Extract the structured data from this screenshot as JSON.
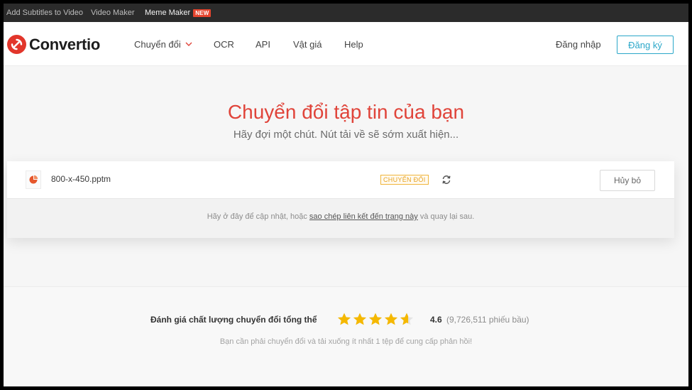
{
  "top_strip": {
    "links": [
      "Add Subtitles to Video",
      "Video Maker",
      "Meme Maker"
    ],
    "new_badge": "NEW"
  },
  "header": {
    "brand": "Convertio",
    "nav": {
      "convert": "Chuyển đổi",
      "ocr": "OCR",
      "api": "API",
      "price": "Vật giá",
      "help": "Help"
    },
    "login": "Đăng nhập",
    "signup": "Đăng ký"
  },
  "hero": {
    "title": "Chuyển đổi tập tin của bạn",
    "subtitle": "Hãy đợi một chút. Nút tải về sẽ sớm xuất hiện..."
  },
  "file_card": {
    "file_name": "800-x-450.pptm",
    "status": "CHUYỂN ĐỔI",
    "cancel": "Hủy bỏ",
    "note_before": "Hãy ở đây để cập nhật, hoặc ",
    "note_link": "sao chép liên kết đến trang này",
    "note_after": " và quay lại sau."
  },
  "rating": {
    "label": "Đánh giá chất lượng chuyển đổi tổng thể",
    "stars": 4.6,
    "score": "4.6",
    "votes": "(9,726,511 phiếu bầu)",
    "note": "Bạn cần phải chuyển đổi và tải xuống ít nhất 1 tệp để cung cấp phản hồi!"
  },
  "colors": {
    "brand_red": "#e2362b",
    "title_red": "#e0443a",
    "accent_blue": "#2aa7c9",
    "status_orange": "#e8a322",
    "star_yellow": "#f5b800"
  },
  "icons": [
    "convertio-logo-icon",
    "chevron-down-icon",
    "pptm-file-icon",
    "refresh-icon",
    "star-icon"
  ]
}
